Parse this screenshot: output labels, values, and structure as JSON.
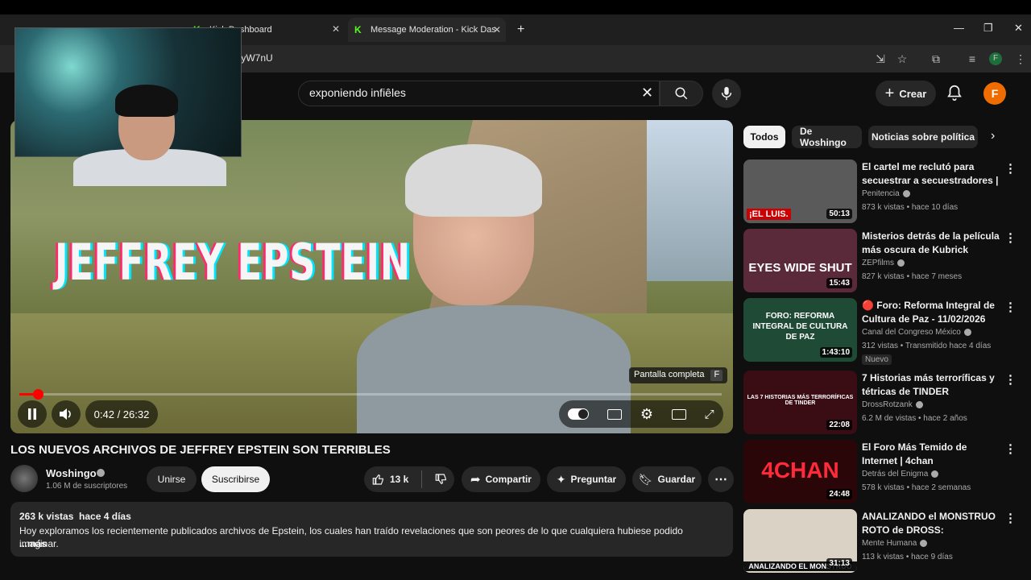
{
  "browser": {
    "tabs": [
      {
        "title": "Kick Dashboard"
      },
      {
        "title": "Message Moderation - Kick Das"
      }
    ],
    "new_tab": "+",
    "url_fragment": "fyW7nU",
    "profile_letter": "F",
    "window_controls": {
      "minimize": "—",
      "restore": "❐",
      "close": "✕"
    }
  },
  "header": {
    "search_value": "exponiendo infiêles",
    "create_label": "Crear",
    "user_initial": "F"
  },
  "player": {
    "overlay_title": "JEFFREY EPSTEIN",
    "time": "0:42 / 26:32",
    "progress_fraction": 0.026,
    "tooltip_label": "Pantalla completa",
    "tooltip_key": "F"
  },
  "video": {
    "title": "LOS NUEVOS ARCHIVOS DE JEFFREY EPSTEIN SON TERRIBLES",
    "channel": "Woshingo",
    "subscribers": "1.06 M de suscriptores",
    "join_label": "Unirse",
    "subscribe_label": "Suscribirse",
    "likes": "13 k",
    "share_label": "Compartir",
    "ask_label": "Preguntar",
    "save_label": "Guardar",
    "description": {
      "meta": "263 k vistas  hace 4 días",
      "text": "Hoy exploramos los recientemente publicados archivos de Epstein, los cuales han traído revelaciones que son peores de lo que cualquiera hubiese podido imaginar.",
      "more": "...más"
    }
  },
  "chips": [
    "Todos",
    "De Woshingo",
    "Noticias sobre política"
  ],
  "recommendations": [
    {
      "title": "El cartel me reclutó para secuestrar a secuestradores | ...",
      "channel": "Penitencia",
      "meta": "873 k vistas • hace 10 días",
      "duration": "50:13",
      "thumb_text": "¡EL LUIS.",
      "thumb_bg": "#5a5a5a"
    },
    {
      "title": "Misterios detrás de la película más oscura de Kubrick",
      "channel": "ZEPfilms",
      "meta": "827 k vistas • hace 7 meses",
      "duration": "15:43",
      "thumb_text": "EYES WIDE SHUT",
      "thumb_bg": "#5b2a3a"
    },
    {
      "title": "🔴 Foro: Reforma Integral de Cultura de Paz - 11/02/2026",
      "channel": "Canal del Congreso México",
      "meta": "312 vistas • Transmitido hace 4 días",
      "badge": "Nuevo",
      "duration": "1:43:10",
      "thumb_text": "FORO: REFORMA INTEGRAL DE CULTURA DE PAZ",
      "thumb_bg": "#1f4a35"
    },
    {
      "title": "7 Historias más terroríficas y tétricas de TINDER",
      "channel": "DrossRotzank",
      "meta": "6.2 M de vistas • hace 2 años",
      "duration": "22:08",
      "thumb_text": "LAS 7 HISTORIAS MÁS TERRORÍFICAS DE TINDER",
      "thumb_bg": "#3a0c14"
    },
    {
      "title": "El Foro Más Temido de Internet | 4chan",
      "channel": "Detrás del Enigma",
      "meta": "578 k vistas • hace 2 semanas",
      "duration": "24:48",
      "thumb_text": "4CHAN",
      "thumb_bg": "#2a0608"
    },
    {
      "title": "ANALIZANDO el MONSTRUO ROTO de DROSS: ¿PSIQUIATR...",
      "channel": "Mente Humana",
      "meta": "113 k vistas • hace 9 días",
      "duration": "31:13",
      "thumb_text": "ANALIZANDO EL MONSTRUO",
      "thumb_bg": "#d9d2c5"
    }
  ]
}
